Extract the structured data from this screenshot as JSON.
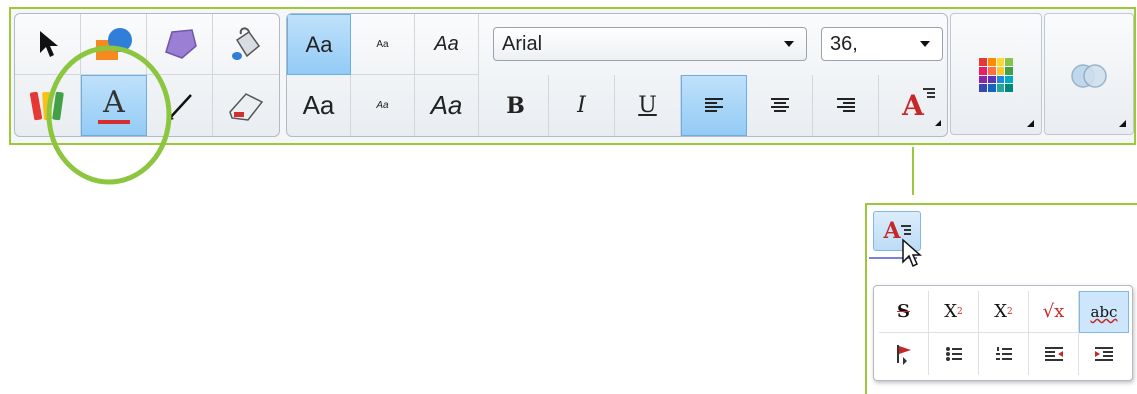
{
  "toolbar": {
    "tools": [
      {
        "name": "select",
        "icon": "cursor-arrow-icon"
      },
      {
        "name": "shapes",
        "icon": "shapes-icon"
      },
      {
        "name": "polygon",
        "icon": "polygon-icon"
      },
      {
        "name": "fill",
        "icon": "paint-bucket-icon"
      },
      {
        "name": "pens",
        "icon": "pens-icon"
      },
      {
        "name": "text",
        "icon": "text-tool-icon",
        "label": "A",
        "selected": true
      },
      {
        "name": "line",
        "icon": "line-icon"
      },
      {
        "name": "eraser",
        "icon": "eraser-icon"
      }
    ],
    "styles_row1": [
      "Aa",
      "Aa",
      "Aa"
    ],
    "styles_row2": [
      "Aa",
      "Aa",
      "Aa"
    ],
    "font_family": "Arial",
    "font_size": "36,",
    "format_buttons": {
      "bold": "B",
      "italic": "I",
      "underline": "U"
    },
    "align": [
      "left",
      "center",
      "right"
    ],
    "align_selected": "left",
    "text_options_label": "A",
    "color_swatches": [
      "#e53935",
      "#fb8c00",
      "#fdd835",
      "#8bc34a",
      "#e91e63",
      "#ff7043",
      "#ffca28",
      "#43a047",
      "#8e24aa",
      "#5e35b1",
      "#1e88e5",
      "#00acc1",
      "#3949ab",
      "#1565c0",
      "#26a69a",
      "#00897b"
    ],
    "accent_highlight": "#8cc63f"
  },
  "popup": {
    "anchor_label": "A",
    "row1": [
      {
        "name": "strikethrough",
        "label": "S"
      },
      {
        "name": "subscript",
        "label": "X",
        "mark": "2"
      },
      {
        "name": "superscript",
        "label": "X",
        "mark": "2"
      },
      {
        "name": "equation",
        "label": "√x"
      },
      {
        "name": "spell-check",
        "label": "abc",
        "selected": true
      }
    ],
    "row2": [
      {
        "name": "text-direction",
        "icon": "flag-icon"
      },
      {
        "name": "bullets",
        "icon": "bullet-list-icon"
      },
      {
        "name": "numbering",
        "icon": "numbered-list-icon"
      },
      {
        "name": "decrease-indent",
        "icon": "outdent-icon"
      },
      {
        "name": "increase-indent",
        "icon": "indent-icon"
      }
    ]
  }
}
